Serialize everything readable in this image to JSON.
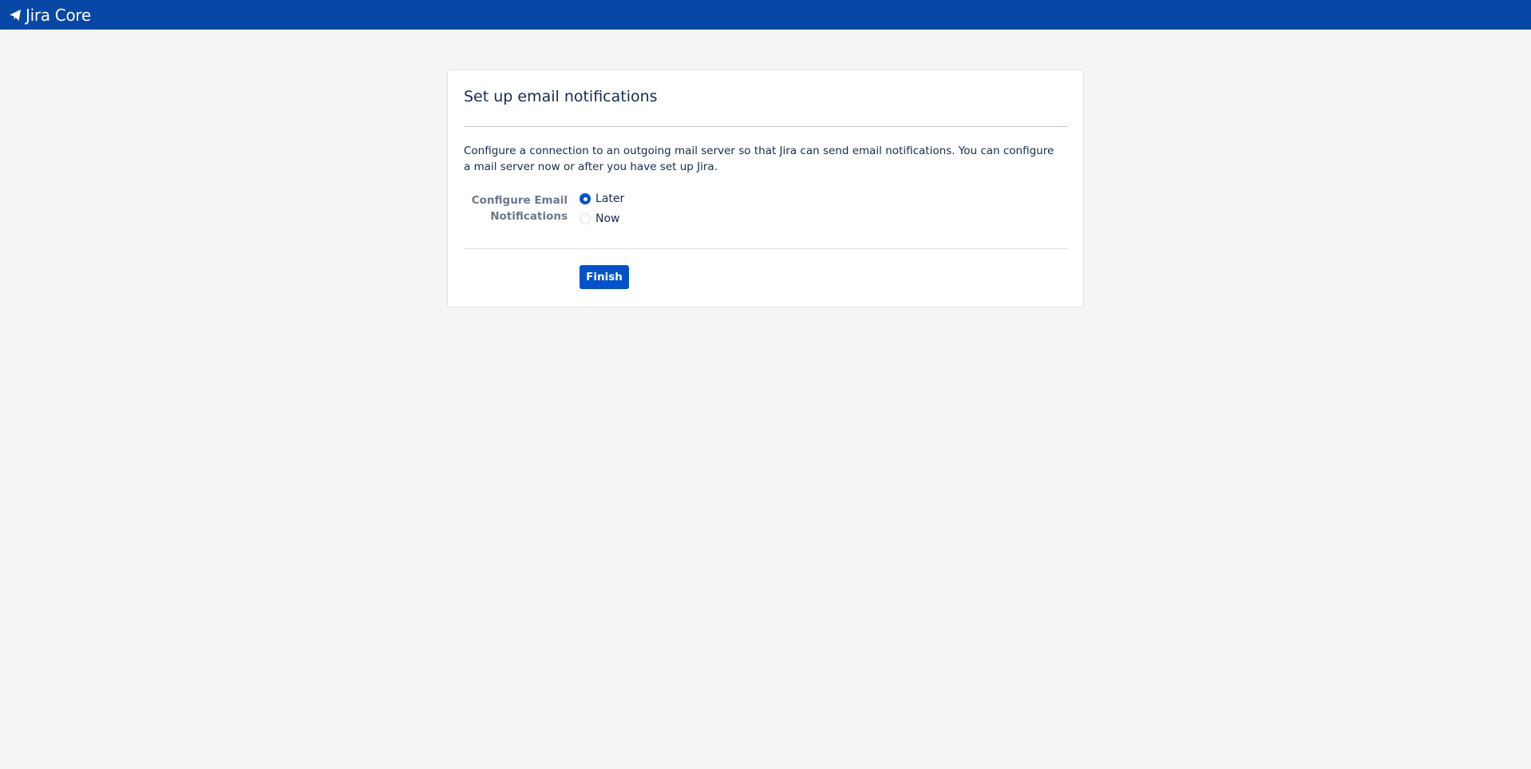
{
  "header": {
    "product_name": "Jira Core",
    "logo_icon": "jira-core-logo-icon",
    "background_color": "#0747a6"
  },
  "setup": {
    "title": "Set up email notifications",
    "description": "Configure a connection to an outgoing mail server so that Jira can send email notifications. You can configure a mail server now or after you have set up Jira.",
    "field_label": "Configure Email Notifications",
    "options": [
      {
        "label": "Later",
        "selected": true
      },
      {
        "label": "Now",
        "selected": false
      }
    ],
    "finish_label": "Finish",
    "accent_color": "#0052cc"
  }
}
